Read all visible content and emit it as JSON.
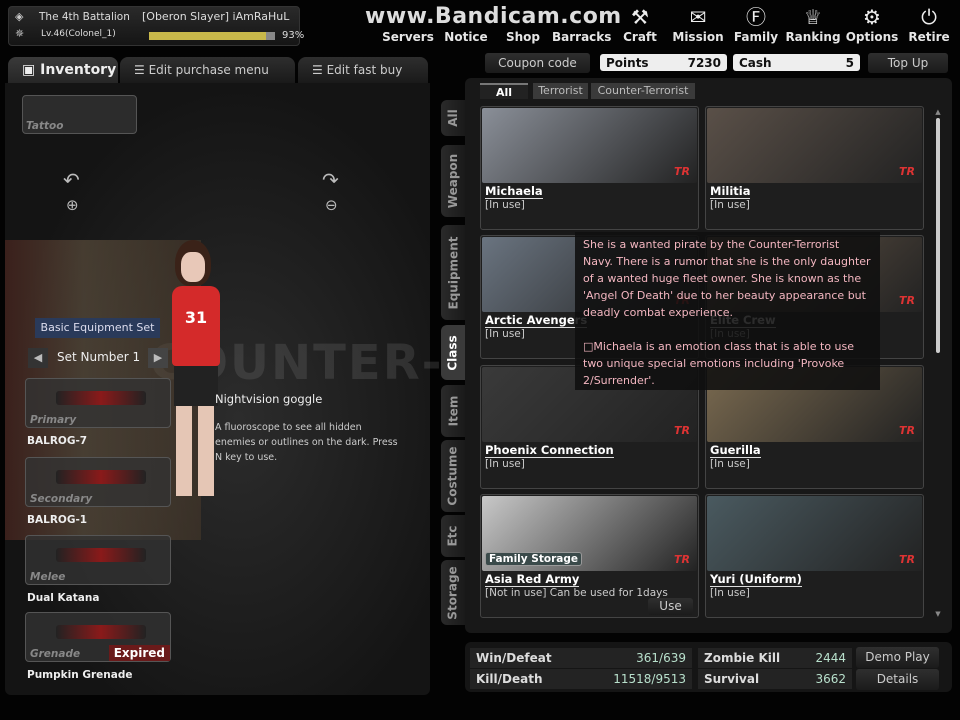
{
  "player": {
    "clan": "The 4th Battalion",
    "name": "[Oberon Slayer] iAmRaHuL",
    "level": "Lv.46(Colonel_1)",
    "xp_percent": 93,
    "xp_label": "93%"
  },
  "watermark": "www.Bandicam.com",
  "nav": [
    {
      "label": "Servers",
      "icon": "server-icon"
    },
    {
      "label": "Notice",
      "icon": "notice-icon"
    },
    {
      "label": "Shop",
      "icon": "shop-icon"
    },
    {
      "label": "Barracks",
      "icon": "barracks-icon"
    },
    {
      "label": "Craft",
      "icon": "hammer-icon"
    },
    {
      "label": "Mission",
      "icon": "scroll-icon"
    },
    {
      "label": "Family",
      "icon": "shield-icon"
    },
    {
      "label": "Ranking",
      "icon": "trophy-icon"
    },
    {
      "label": "Options",
      "icon": "gear-icon"
    },
    {
      "label": "Retire",
      "icon": "power-icon"
    }
  ],
  "tabs": [
    "Inventory",
    "Edit purchase menu",
    "Edit fast buy"
  ],
  "left": {
    "tattoo": "Tattoo",
    "equip_set": "Basic Equipment Set",
    "set_number": "Set Number 1",
    "bg_text": "COUNTER-STRIKE",
    "slots": [
      {
        "slot": "Primary",
        "name": "BALROG-7"
      },
      {
        "slot": "Secondary",
        "name": "BALROG-1"
      },
      {
        "slot": "Melee",
        "name": "Dual Katana"
      },
      {
        "slot": "Grenade",
        "name": "Pumpkin Grenade",
        "badge": "Expired"
      }
    ],
    "item_tip": {
      "title": "Nightvision goggle",
      "desc": "A fluoroscope to see all hidden enemies or outlines on the dark. Press N key to use."
    }
  },
  "shop": {
    "coupon": "Coupon code",
    "points_label": "Points",
    "points": "7230",
    "cash_label": "Cash",
    "cash": "5",
    "topup": "Top Up"
  },
  "filters": [
    "All",
    "Terrorist",
    "Counter-Terrorist"
  ],
  "vtabs": [
    "All",
    "Weapon",
    "Equipment",
    "Class",
    "Item",
    "Costume",
    "Etc",
    "Storage"
  ],
  "cards": [
    {
      "name": "Michaela",
      "status": "[In use]",
      "team": "TR"
    },
    {
      "name": "Militia",
      "status": "[In use]",
      "team": "TR"
    },
    {
      "name": "Arctic Avengers",
      "status": "[In use]",
      "team": "TR"
    },
    {
      "name": "Elite Crew",
      "status": "[In use]",
      "team": "TR"
    },
    {
      "name": "Phoenix Connection",
      "status": "[In use]",
      "team": "TR"
    },
    {
      "name": "Guerilla",
      "status": "[In use]",
      "team": "TR"
    },
    {
      "name": "Asia Red Army",
      "status": "[Not in use] Can be used for 1days",
      "team": "TR",
      "badge": "Family Storage",
      "action": "Use"
    },
    {
      "name": "Yuri (Uniform)",
      "status": "[In use]",
      "team": "TR"
    }
  ],
  "tooltip": {
    "p1": "She is a wanted pirate by the Counter-Terrorist Navy. There is a rumor that she is the only daughter of a wanted huge fleet owner. She is known as the 'Angel Of Death' due to her beauty appearance but deadly combat experience.",
    "p2": "□Michaela is an emotion class that is able to use two unique special emotions including 'Provoke 2/Surrender'."
  },
  "stats": {
    "win_label": "Win/Defeat",
    "win": "361/639",
    "kd_label": "Kill/Death",
    "kd": "11518/9513",
    "zk_label": "Zombie Kill",
    "zk": "2444",
    "surv_label": "Survival",
    "surv": "3662",
    "demo": "Demo Play",
    "details": "Details"
  }
}
